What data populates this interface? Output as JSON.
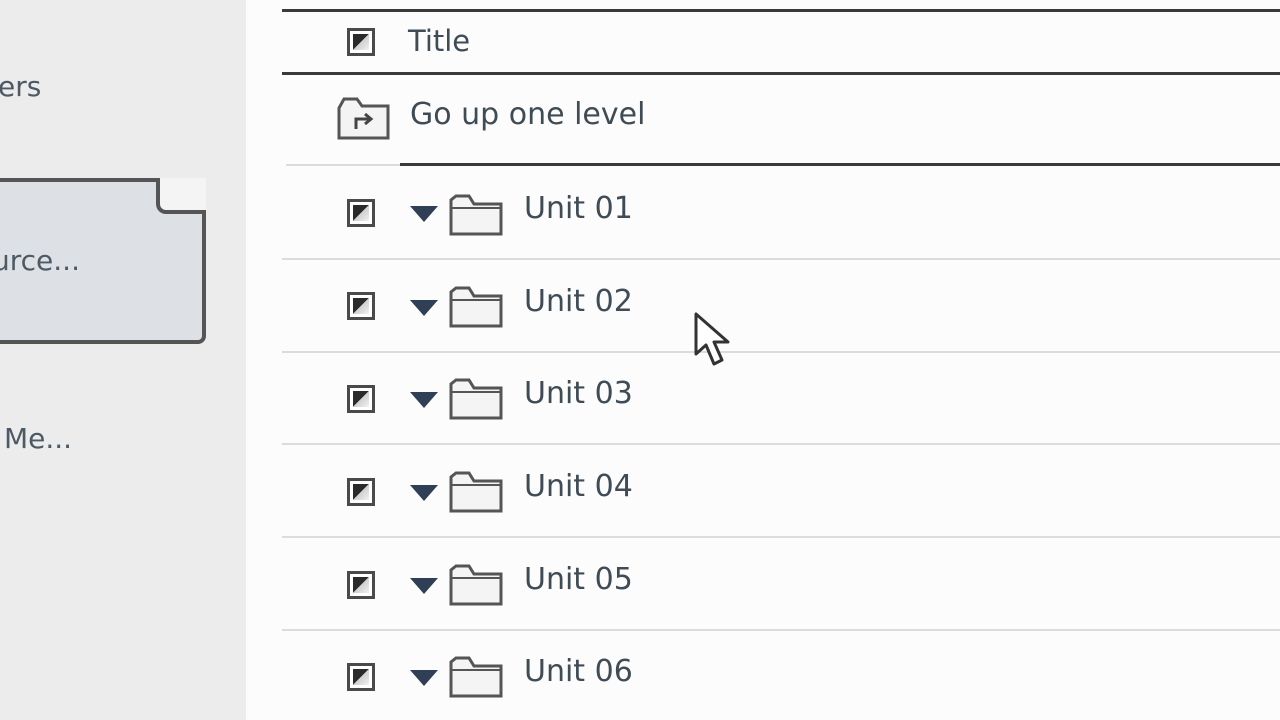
{
  "sidebar": {
    "items": [
      {
        "label": "ers"
      },
      {
        "label": "urce..."
      },
      {
        "label": "Me..."
      }
    ]
  },
  "header": {
    "column_title": "Title"
  },
  "nav": {
    "up_label": "Go up one level"
  },
  "folders": [
    {
      "name": "Unit 01"
    },
    {
      "name": "Unit 02"
    },
    {
      "name": "Unit 03"
    },
    {
      "name": "Unit 04"
    },
    {
      "name": "Unit 05"
    },
    {
      "name": "Unit 06"
    }
  ],
  "icons": {
    "checkbox": "checkbox-icon",
    "expand": "triangle-down-icon",
    "folder": "folder-icon",
    "up": "folder-up-icon",
    "cursor": "mouse-cursor"
  },
  "colors": {
    "text": "#3f4b55",
    "caret": "#2f3f55",
    "sidebar_bg": "#ececec"
  }
}
